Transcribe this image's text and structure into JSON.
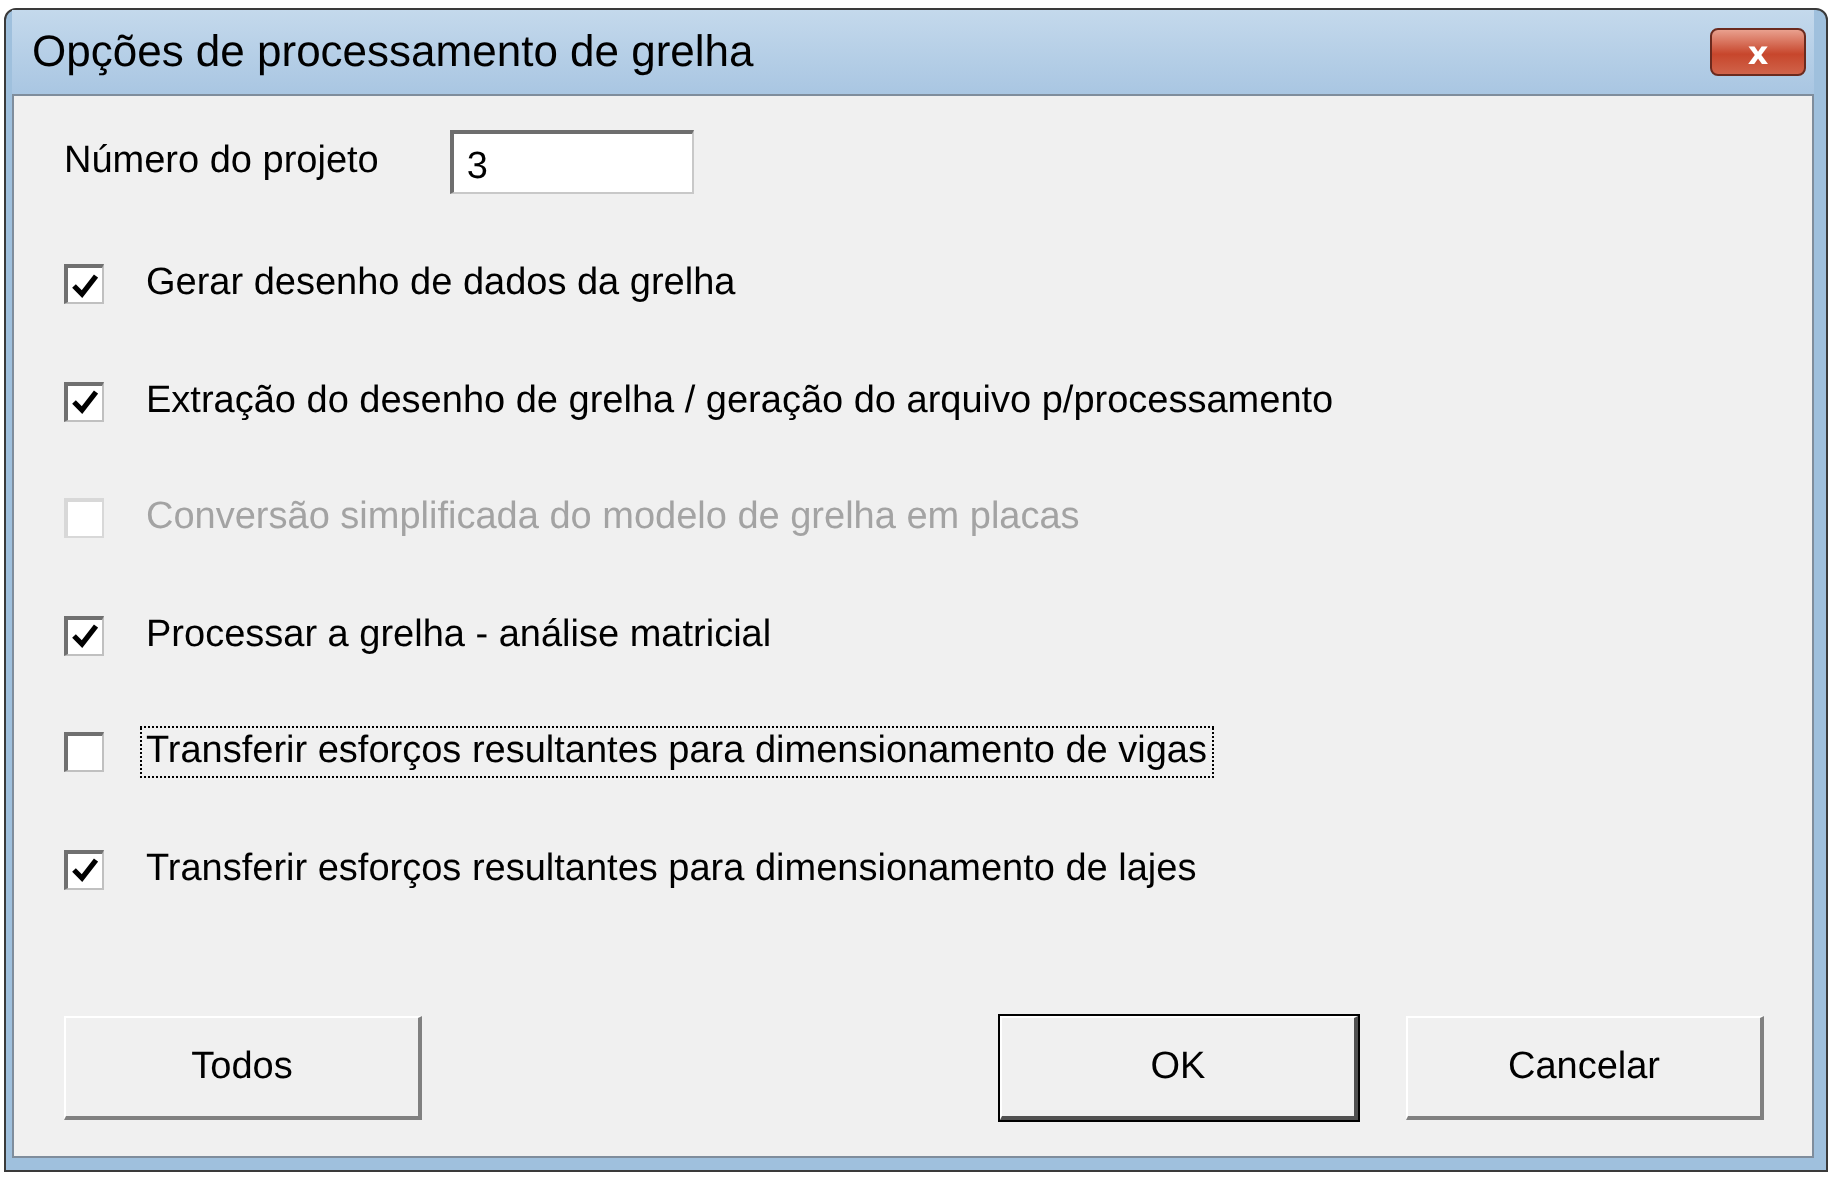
{
  "window": {
    "title": "Opções de processamento de grelha",
    "close_label": "x"
  },
  "project_number": {
    "label": "Número do projeto",
    "value": "3"
  },
  "options": [
    {
      "label": "Gerar desenho de dados da grelha",
      "checked": true,
      "disabled": false,
      "focused": false
    },
    {
      "label": "Extração do desenho de grelha / geração do arquivo p/processamento",
      "checked": true,
      "disabled": false,
      "focused": false
    },
    {
      "label": "Conversão simplificada do modelo de grelha em placas",
      "checked": false,
      "disabled": true,
      "focused": false
    },
    {
      "label": "Processar a grelha - análise matricial",
      "checked": true,
      "disabled": false,
      "focused": false
    },
    {
      "label": "Transferir esforços resultantes para dimensionamento de vigas",
      "checked": false,
      "disabled": false,
      "focused": true
    },
    {
      "label": "Transferir esforços resultantes para dimensionamento de lajes",
      "checked": true,
      "disabled": false,
      "focused": false
    }
  ],
  "buttons": [
    {
      "label": "Todos",
      "default": false
    },
    {
      "label": "OK",
      "default": true
    },
    {
      "label": "Cancelar",
      "default": false
    }
  ]
}
